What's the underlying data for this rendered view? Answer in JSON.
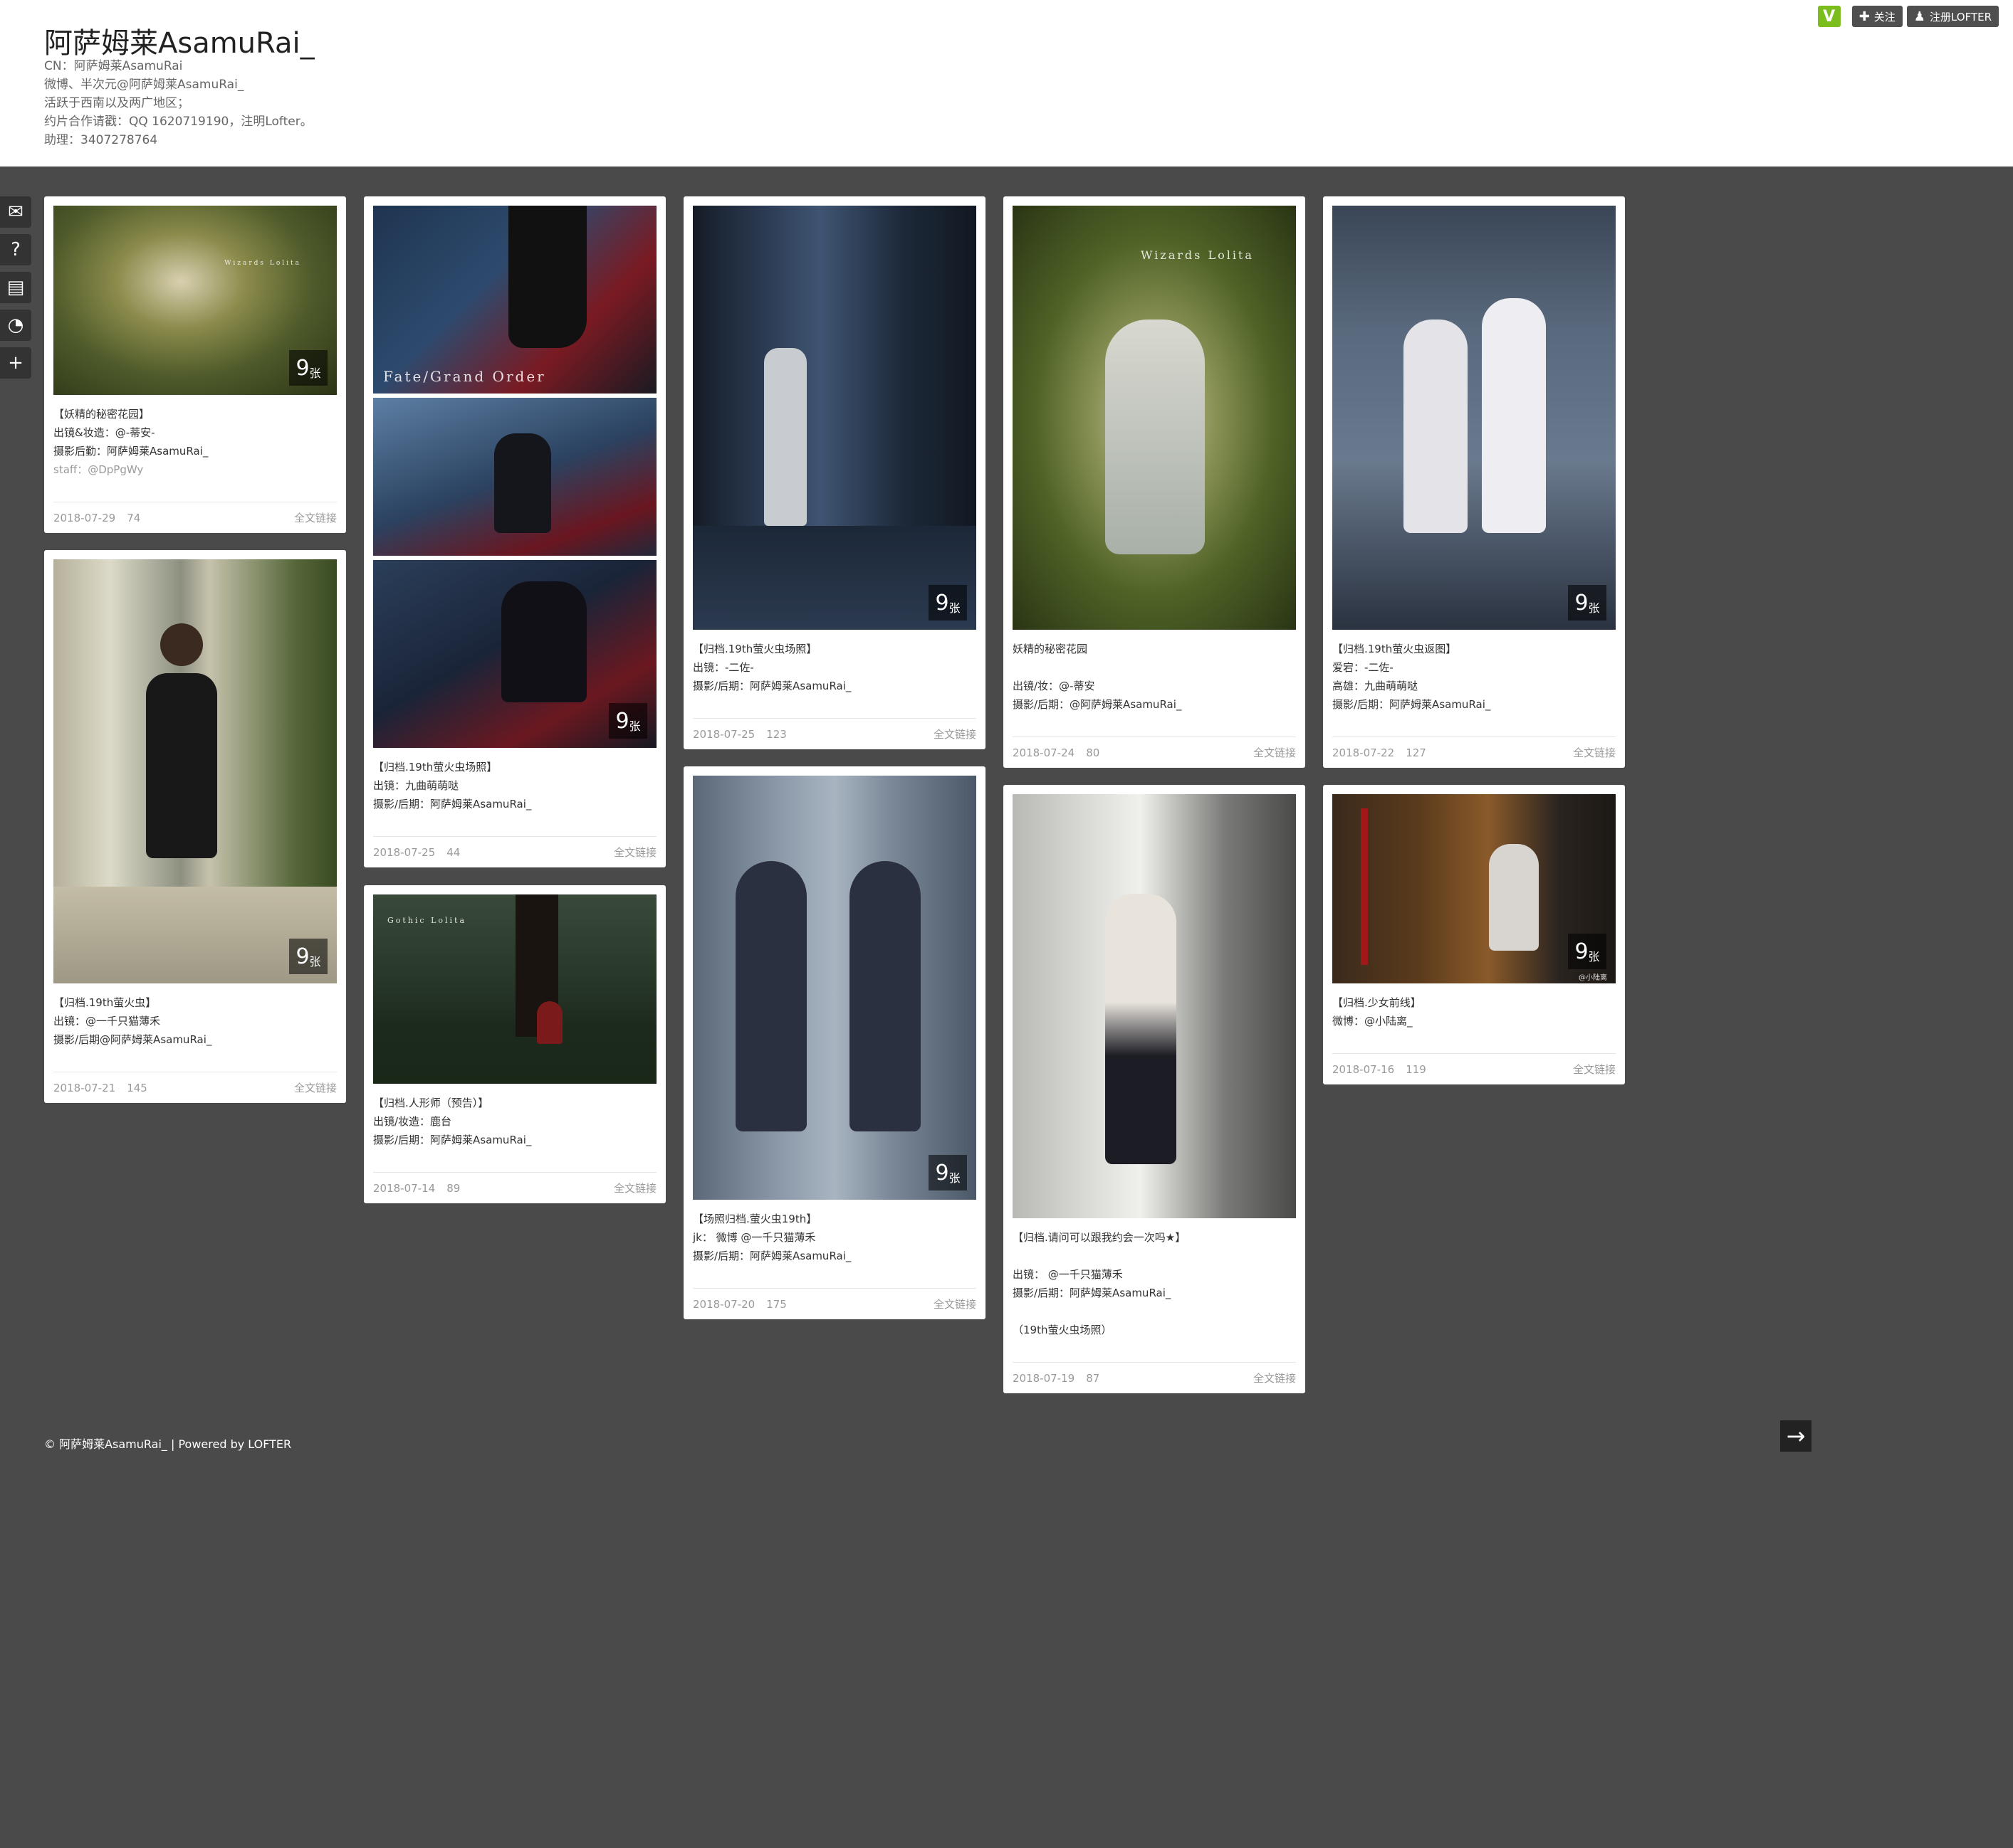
{
  "blog": {
    "title": "阿萨姆莱AsamuRai_",
    "desc": [
      "CN：阿萨姆莱AsamuRai",
      "微博、半次元@阿萨姆莱AsamuRai_",
      "活跃于西南以及两广地区；",
      "约片合作请戳：QQ 1620719190，注明Lofter。",
      "助理：3407278764"
    ]
  },
  "topbar": {
    "badge": "V",
    "follow_icon": "✚",
    "follow": "关注",
    "register_icon": "♟",
    "register": "注册LOFTER"
  },
  "sidenav": [
    {
      "icon": "mail-icon",
      "glyph": "✉"
    },
    {
      "icon": "help-icon",
      "glyph": "?"
    },
    {
      "icon": "archive-icon",
      "glyph": "▤"
    },
    {
      "icon": "rss-icon",
      "glyph": "◔"
    },
    {
      "icon": "add-icon",
      "glyph": "+"
    }
  ],
  "posts": [
    {
      "id": "p1",
      "count_n": "9",
      "count_z": "张",
      "watermark": "Wizards Lolita",
      "lines": [
        "【妖精的秘密花园】",
        "出镜&妆造：@-蒂安-",
        "摄影后勤：阿萨姆莱AsamuRai_",
        "staff：@DpPgWy"
      ],
      "date": "2018-07-29",
      "hot": "74",
      "link": "全文链接"
    },
    {
      "id": "p2",
      "count_n": "9",
      "count_z": "张",
      "watermark": "Fate/Grand Order",
      "lines": [
        "【归档.19th萤火虫场照】",
        "出镜：九曲萌萌哒",
        "摄影/后期：阿萨姆莱AsamuRai_"
      ],
      "date": "2018-07-25",
      "hot": "44",
      "link": "全文链接"
    },
    {
      "id": "p3",
      "count_n": "9",
      "count_z": "张",
      "lines": [
        "【归档.19th萤火虫场照】",
        "出镜：-二佐-",
        "摄影/后期：阿萨姆莱AsamuRai_"
      ],
      "date": "2018-07-25",
      "hot": "123",
      "link": "全文链接"
    },
    {
      "id": "p4",
      "watermark": "Wizards Lolita",
      "lines": [
        "妖精的秘密花园",
        "",
        "出镜/妆：@-蒂安",
        "摄影/后期：@阿萨姆莱AsamuRai_"
      ],
      "date": "2018-07-24",
      "hot": "80",
      "link": "全文链接"
    },
    {
      "id": "p5",
      "count_n": "9",
      "count_z": "张",
      "lines": [
        "【归档.19th萤火虫返图】",
        "爱宕：-二佐-",
        "高雄：九曲萌萌哒",
        "摄影/后期：阿萨姆莱AsamuRai_"
      ],
      "date": "2018-07-22",
      "hot": "127",
      "link": "全文链接"
    },
    {
      "id": "p6",
      "count_n": "9",
      "count_z": "张",
      "lines": [
        "【归档.19th萤火虫】",
        "出镜：@一千只猫薄禾",
        "摄影/后期@阿萨姆莱AsamuRai_"
      ],
      "date": "2018-07-21",
      "hot": "145",
      "link": "全文链接"
    },
    {
      "id": "p7",
      "watermark": "Gothic Lolita",
      "lines": [
        "【归档.人形师（预告）】",
        "出镜/妆造：鹿台",
        "摄影/后期：阿萨姆莱AsamuRai_"
      ],
      "date": "2018-07-14",
      "hot": "89",
      "link": "全文链接"
    },
    {
      "id": "p8",
      "count_n": "9",
      "count_z": "张",
      "lines": [
        "【场照归档.萤火虫19th】",
        "jk：  微博 @一千只猫薄禾",
        "摄影/后期：阿萨姆莱AsamuRai_"
      ],
      "date": "2018-07-20",
      "hot": "175",
      "link": "全文链接"
    },
    {
      "id": "p9",
      "lines": [
        "【归档.请问可以跟我约会一次吗★】",
        "",
        "出镜：  @一千只猫薄禾",
        "摄影/后期：阿萨姆莱AsamuRai_",
        "",
        "（19th萤火虫场照）"
      ],
      "date": "2018-07-19",
      "hot": "87",
      "link": "全文链接"
    },
    {
      "id": "p10",
      "count_n": "9",
      "count_z": "张",
      "watermark_small": "@小陆离",
      "lines": [
        "【归档.少女前线】",
        "微博：@小陆离_"
      ],
      "date": "2018-07-16",
      "hot": "119",
      "link": "全文链接"
    }
  ],
  "footer": {
    "text": "© 阿萨姆莱AsamuRai_ | Powered by LOFTER"
  },
  "colors": {
    "page_bg": "#4a4a4a",
    "card_bg": "#ffffff",
    "verified": "#7cbd1e"
  }
}
